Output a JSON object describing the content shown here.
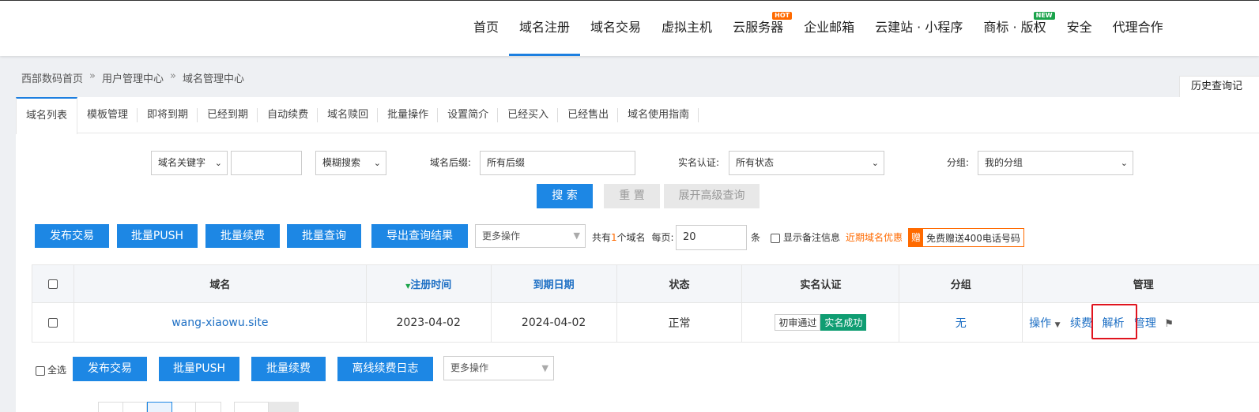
{
  "nav": {
    "items": [
      "首页",
      "域名注册",
      "域名交易",
      "虚拟主机",
      "云服务器",
      "企业邮箱",
      "云建站 · 小程序",
      "商标 · 版权",
      "安全",
      "代理合作"
    ],
    "badge_hot": "HOT",
    "badge_new": "NEW"
  },
  "breadcrumb": {
    "home": "西部数码首页",
    "user_center": "用户管理中心",
    "current": "域名管理中心",
    "sep": "»"
  },
  "history_btn": "历史查询记",
  "tabs": [
    "域名列表",
    "模板管理",
    "即将到期",
    "已经到期",
    "自动续费",
    "域名赎回",
    "批量操作",
    "设置简介",
    "已经买入",
    "已经售出",
    "域名使用指南"
  ],
  "search": {
    "keyword_select": "域名关键字",
    "keyword_value": "",
    "mode_select": "模糊搜索",
    "suffix_label": "域名后缀:",
    "suffix_value": "所有后缀",
    "realname_label": "实名认证:",
    "realname_value": "所有状态",
    "group_label": "分组:",
    "group_value": "我的分组",
    "search_btn": "搜 索",
    "reset_btn": "重 置",
    "advanced_btn": "展开高级查询"
  },
  "actions": {
    "publish": "发布交易",
    "push": "批量PUSH",
    "renew": "批量续费",
    "query": "批量查询",
    "export": "导出查询结果",
    "more": "更多操作",
    "total_prefix": "共有",
    "total_count": "1",
    "total_suffix": "个域名",
    "per_page_label": "每页:",
    "per_page_value": "20",
    "per_page_unit": "条",
    "show_notes": "显示备注信息",
    "expire_promo": "近期域名优惠",
    "gift_icon_text": "赠",
    "gift_text": "免费赠送400电话号码"
  },
  "table": {
    "headers": {
      "domain": "域名",
      "reg_time": "注册时间",
      "expire": "到期日期",
      "status": "状态",
      "realname": "实名认证",
      "group": "分组",
      "manage": "管理"
    },
    "rows": [
      {
        "domain": "wang-xiaowu.site",
        "reg_time": "2023-04-02",
        "expire": "2024-04-02",
        "status": "正常",
        "realname_tag1": "初审通过",
        "realname_tag2": "实名成功",
        "group": "无",
        "op": "操作",
        "renew": "续费",
        "dns": "解析",
        "manage": "管理"
      }
    ]
  },
  "bottom": {
    "select_all": "全选",
    "publish": "发布交易",
    "push": "批量PUSH",
    "renew": "批量续费",
    "offline_log": "离线续费日志",
    "more": "更多操作"
  }
}
